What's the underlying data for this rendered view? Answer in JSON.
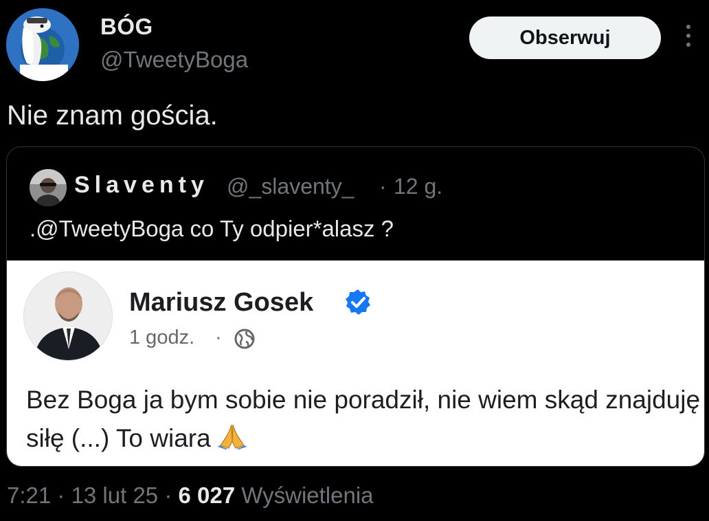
{
  "author": {
    "display_name": "BÓG",
    "handle": "@TweetyBoga",
    "avatar_icon": "god-cartoon-avatar-icon"
  },
  "actions": {
    "follow_label": "Obserwuj",
    "more_icon": "more-vertical-icon"
  },
  "tweet": {
    "text": "Nie znam gościa."
  },
  "quote": {
    "display_name": "Slaventy",
    "handle": "@_slaventy_",
    "separator": "·",
    "time": "12 g.",
    "text": ".@TweetyBoga co Ty odpier*alasz ?",
    "embedded_post": {
      "name": "Mariusz Gosek",
      "verified_icon": "verified-badge-icon",
      "time": "1 godz.",
      "separator": "·",
      "audience_icon": "globe-icon",
      "text": "Bez Boga ja bym sobie nie poradził, nie wiem skąd znajduję siłę (...) To wiara",
      "emoji_icon": "praying-hands-icon"
    }
  },
  "meta": {
    "time": "7:21",
    "sep1": " · ",
    "date": "13 lut 25",
    "sep2": " · ",
    "views_count": "6 027",
    "views_label": " Wyświetlenia"
  },
  "colors": {
    "background": "#000000",
    "text_primary": "#e7e9ea",
    "text_secondary": "#71767b",
    "border": "#333639",
    "follow_bg": "#eff3f4",
    "verified_blue": "#1877f2"
  }
}
